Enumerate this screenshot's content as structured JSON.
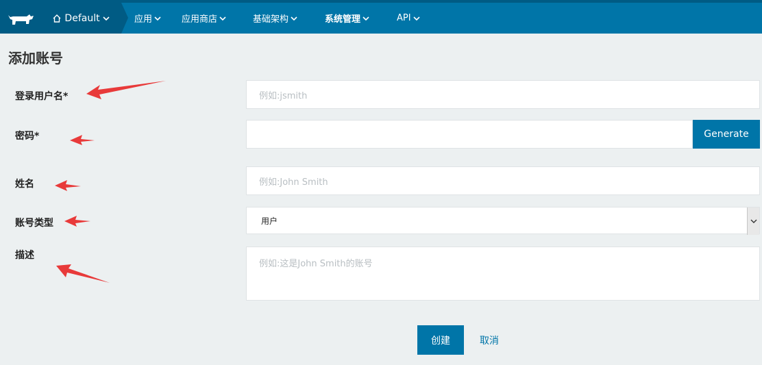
{
  "nav": {
    "env_label": "Default",
    "items": [
      "应用",
      "应用商店",
      "基础架构",
      "系统管理",
      "API"
    ],
    "active_index": 3
  },
  "page": {
    "title": "添加账号"
  },
  "form": {
    "username_label": "登录用户名*",
    "username_placeholder": "例如:jsmith",
    "password_label": "密码*",
    "generate_label": "Generate",
    "name_label": "姓名",
    "name_placeholder": "例如:John Smith",
    "type_label": "账号类型",
    "type_value": "用户",
    "desc_label": "描述",
    "desc_placeholder": "例如:这是John Smith的账号"
  },
  "actions": {
    "create_label": "创建",
    "cancel_label": "取消"
  },
  "colors": {
    "brand": "#0075a8",
    "brand_dark": "#005b84",
    "annotation": "#e83a3a"
  },
  "icons": [
    "cow-logo-icon",
    "home-icon",
    "chevron-down-icon",
    "select-arrow-icon"
  ]
}
